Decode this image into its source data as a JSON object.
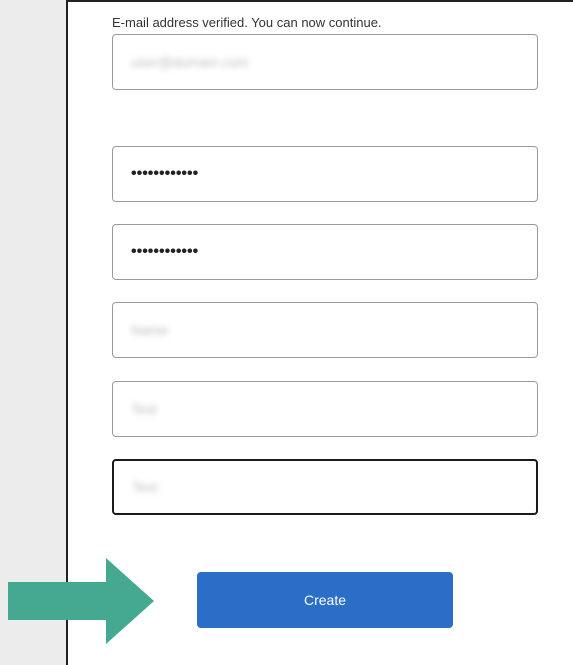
{
  "form": {
    "verified_message": "E-mail address verified. You can now continue.",
    "fields": [
      {
        "value": "user@domain.com",
        "obscured": true
      },
      {
        "value": "••••••••••••",
        "masked": true
      },
      {
        "value": "••••••••••••",
        "masked": true
      },
      {
        "value": "Name",
        "obscured": true
      },
      {
        "value": "Text",
        "obscured": true
      },
      {
        "value": "Text",
        "obscured": true,
        "focused": true
      }
    ],
    "create_label": "Create"
  },
  "colors": {
    "button_bg": "#2a6ec8",
    "arrow": "#45a890",
    "panel_bg": "#ffffff",
    "page_bg": "#ececec"
  },
  "icons": {
    "pointer_arrow": "right-arrow-icon"
  }
}
